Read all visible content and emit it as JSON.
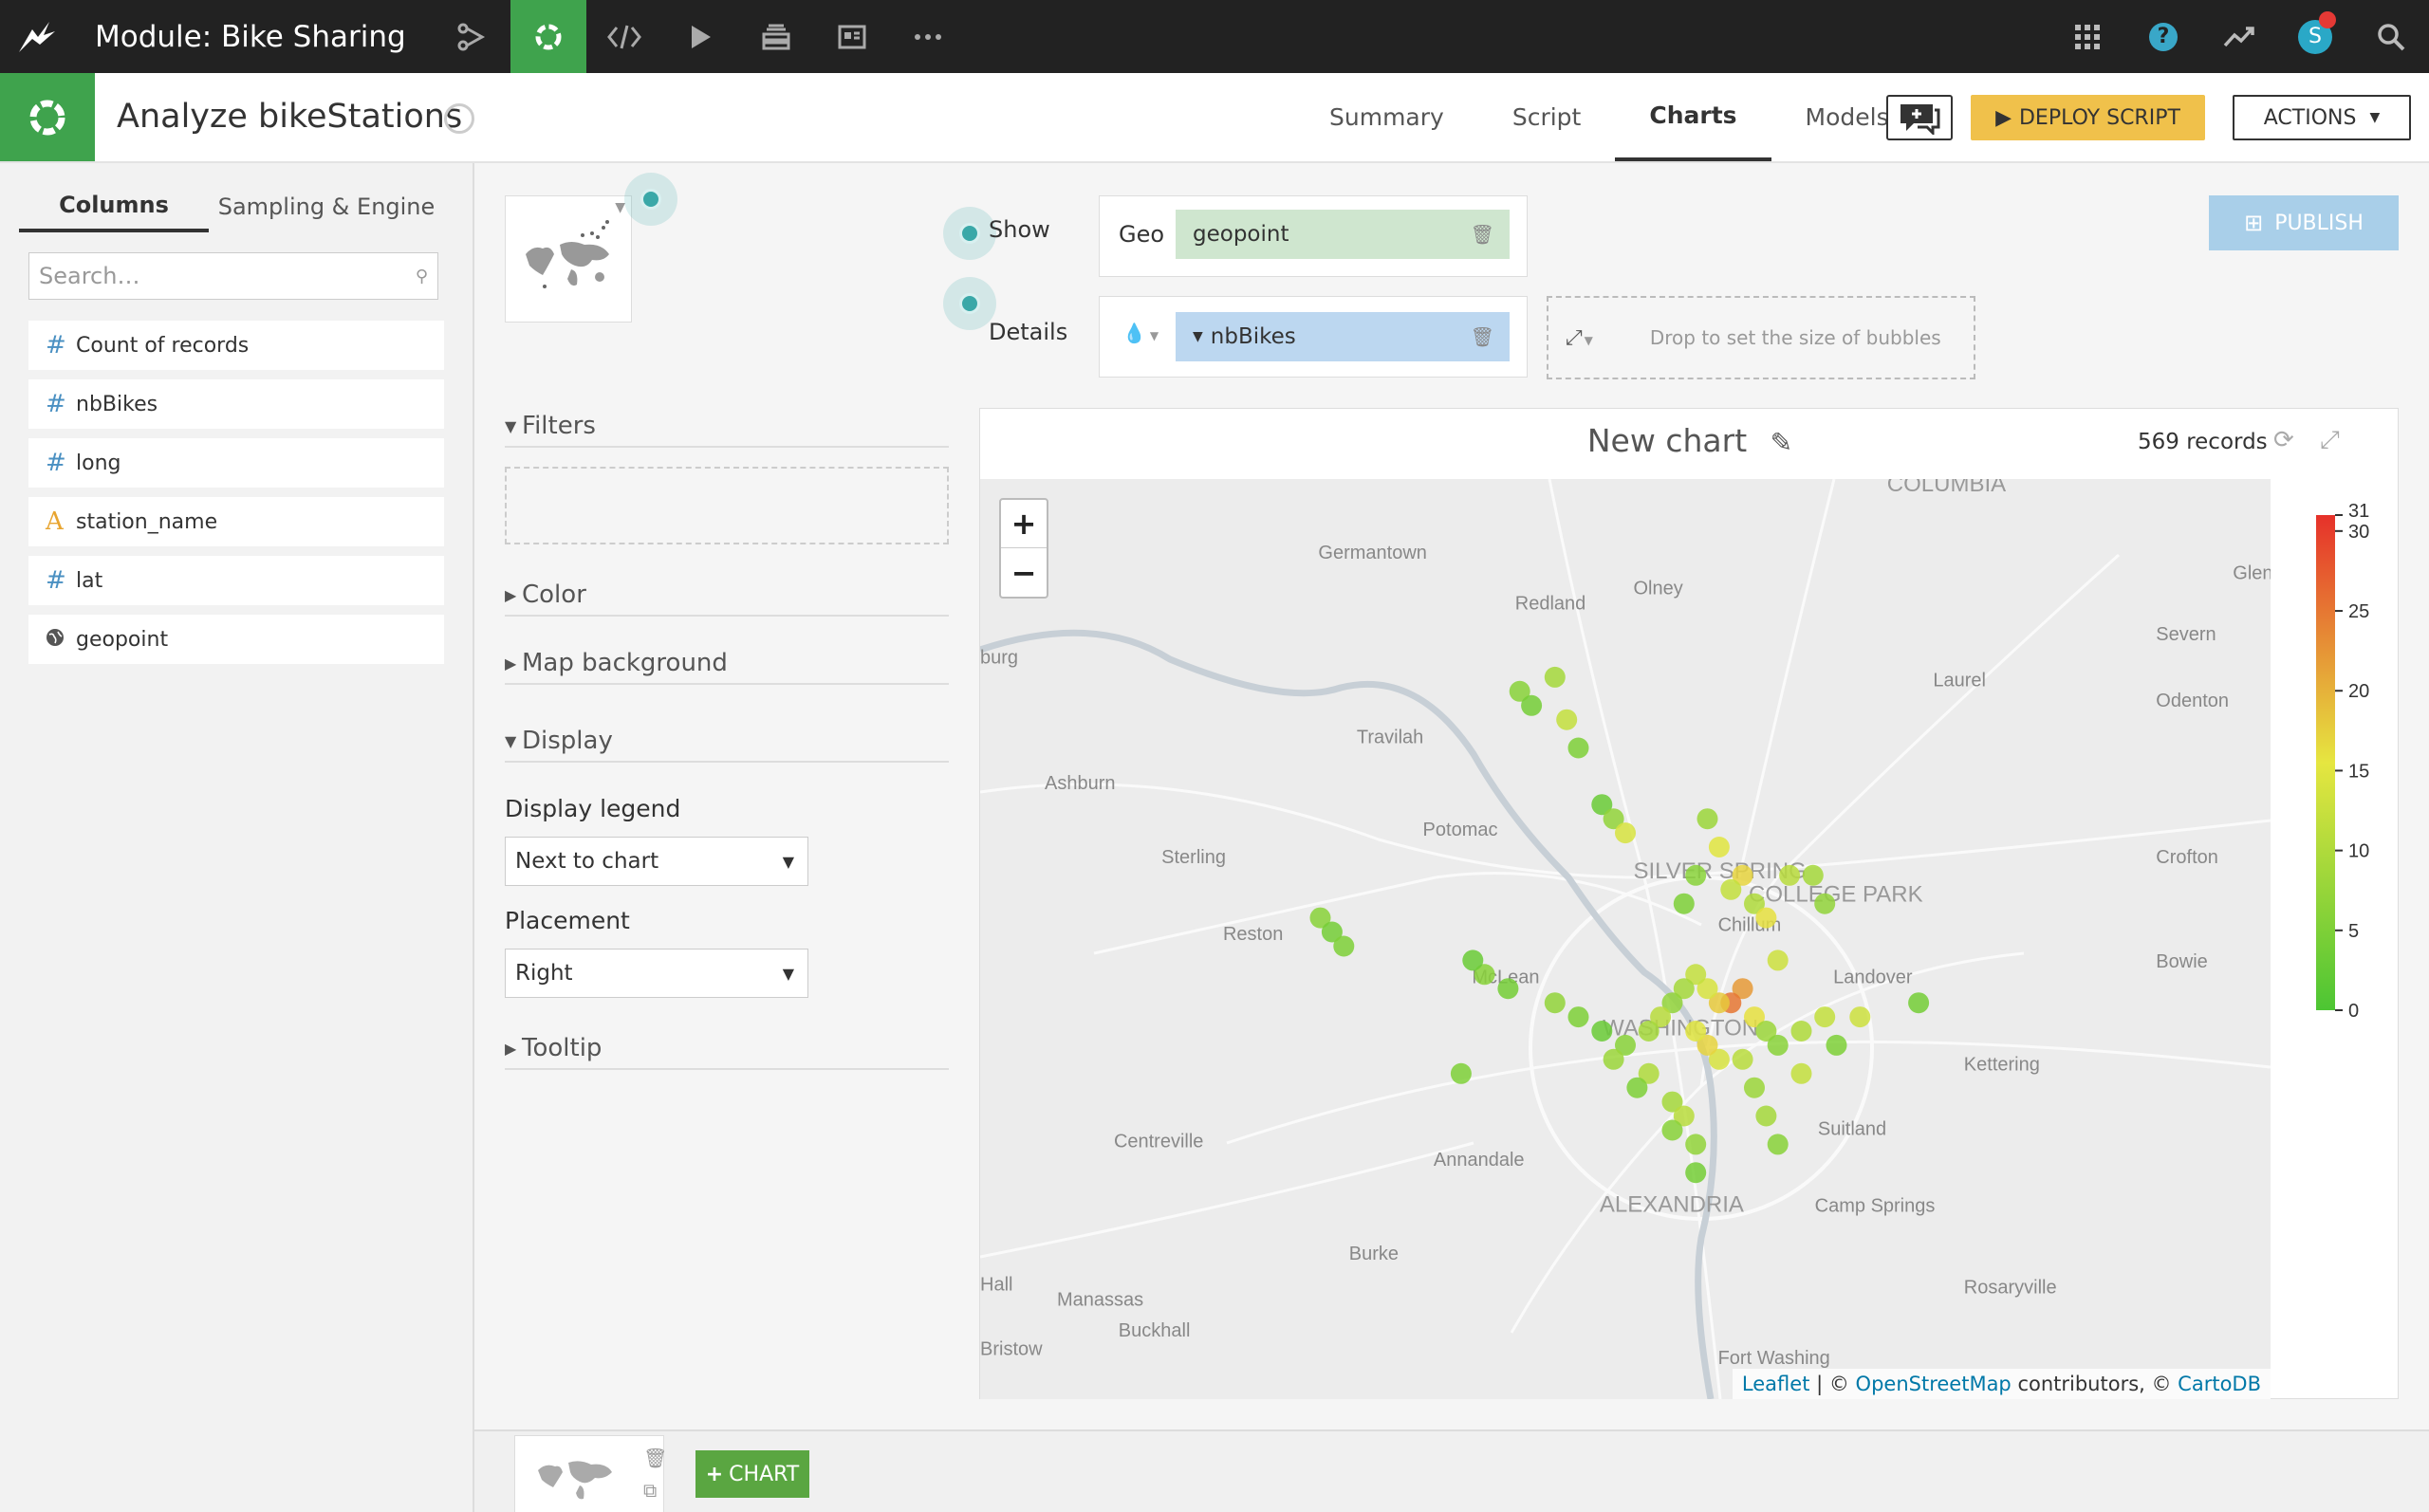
{
  "topbar": {
    "module_title": "Module: Bike Sharing",
    "nav_icons": [
      "flow-icon",
      "analysis-icon",
      "code-icon",
      "run-icon",
      "jobs-icon",
      "dashboard-icon",
      "more-icon"
    ],
    "user_initial": "S"
  },
  "subheader": {
    "title": "Analyze bikeStations",
    "tabs": [
      "Summary",
      "Script",
      "Charts",
      "Models"
    ],
    "active_tab": "Charts",
    "deploy_label": "DEPLOY SCRIPT",
    "actions_label": "ACTIONS"
  },
  "left_panel": {
    "tabs": [
      "Columns",
      "Sampling & Engine"
    ],
    "search_placeholder": "Search…",
    "columns": [
      {
        "type": "#",
        "name": "Count of records"
      },
      {
        "type": "#",
        "name": "nbBikes"
      },
      {
        "type": "#",
        "name": "long"
      },
      {
        "type": "A",
        "name": "station_name"
      },
      {
        "type": "#",
        "name": "lat"
      },
      {
        "type": "globe",
        "name": "geopoint"
      }
    ]
  },
  "config": {
    "show_label": "Show",
    "details_label": "Details",
    "geo_label": "Geo",
    "geo_value": "geopoint",
    "color_value": "nbBikes",
    "size_placeholder": "Drop to set the size of bubbles",
    "publish_label": "PUBLISH",
    "sections": {
      "filters": "Filters",
      "color": "Color",
      "map_background": "Map background",
      "display": "Display",
      "tooltip": "Tooltip"
    },
    "display_legend_label": "Display legend",
    "display_legend_value": "Next to chart",
    "placement_label": "Placement",
    "placement_value": "Right"
  },
  "chart": {
    "title": "New chart",
    "records": "569 records",
    "attribution": {
      "leaflet": "Leaflet",
      "sep1": " | © ",
      "osm": "OpenStreetMap",
      "mid": " contributors, © ",
      "carto": "CartoDB"
    },
    "legend": {
      "ticks": [
        0,
        5,
        10,
        15,
        20,
        25,
        30,
        31
      ],
      "min": 0,
      "max": 31,
      "colors": [
        "#4cc533",
        "#e6e640",
        "#e6312a"
      ]
    },
    "map_labels": [
      "Germantown",
      "Redland",
      "Olney",
      "Glen",
      "Severn",
      "Laurel",
      "Odenton",
      "burg",
      "Travilah",
      "Ashburn",
      "Potomac",
      "Sterling",
      "SILVER SPRING",
      "COLLEGE PARK",
      "Crofton",
      "Chillum",
      "Reston",
      "McLean",
      "Landover",
      "Bowie",
      "WASHINGTON",
      "Kettering",
      "Centreville",
      "Annandale",
      "Suitland",
      "ALEXANDRIA",
      "Camp Springs",
      "Burke",
      "Hall",
      "Manassas",
      "Buckhall",
      "Bristow",
      "Rosaryville",
      "Fort Washing",
      "COLUMBIA"
    ],
    "zoom_in": "+",
    "zoom_out": "−"
  },
  "bottom": {
    "add_chart_label": "CHART"
  },
  "chart_data": {
    "type": "scatter",
    "title": "New chart",
    "records": 569,
    "color_by": "nbBikes",
    "color_range": [
      0,
      31
    ],
    "points": [
      [
        -77.19,
        39.12,
        6
      ],
      [
        -77.18,
        39.11,
        4
      ],
      [
        -77.16,
        39.13,
        9
      ],
      [
        -77.15,
        39.1,
        12
      ],
      [
        -77.14,
        39.08,
        5
      ],
      [
        -77.12,
        39.04,
        3
      ],
      [
        -77.11,
        39.03,
        7
      ],
      [
        -77.1,
        39.02,
        14
      ],
      [
        -77.03,
        39.03,
        8
      ],
      [
        -77.02,
        39.01,
        15
      ],
      [
        -77.0,
        38.99,
        17
      ],
      [
        -77.01,
        38.98,
        12
      ],
      [
        -77.04,
        38.99,
        6
      ],
      [
        -77.05,
        38.97,
        5
      ],
      [
        -76.99,
        38.97,
        10
      ],
      [
        -76.98,
        38.96,
        16
      ],
      [
        -76.96,
        38.99,
        11
      ],
      [
        -76.94,
        38.99,
        9
      ],
      [
        -76.93,
        38.97,
        7
      ],
      [
        -76.97,
        38.93,
        13
      ],
      [
        -77.0,
        38.91,
        22
      ],
      [
        -77.01,
        38.9,
        25
      ],
      [
        -77.02,
        38.9,
        18
      ],
      [
        -77.03,
        38.91,
        14
      ],
      [
        -77.04,
        38.92,
        12
      ],
      [
        -77.05,
        38.91,
        9
      ],
      [
        -77.06,
        38.9,
        7
      ],
      [
        -77.07,
        38.89,
        11
      ],
      [
        -76.99,
        38.89,
        16
      ],
      [
        -76.98,
        38.88,
        8
      ],
      [
        -76.97,
        38.87,
        6
      ],
      [
        -76.95,
        38.88,
        10
      ],
      [
        -76.93,
        38.89,
        12
      ],
      [
        -76.92,
        38.87,
        5
      ],
      [
        -76.9,
        38.89,
        13
      ],
      [
        -76.85,
        38.9,
        4
      ],
      [
        -77.08,
        38.88,
        9
      ],
      [
        -77.1,
        38.87,
        6
      ],
      [
        -77.11,
        38.86,
        8
      ],
      [
        -77.12,
        38.88,
        3
      ],
      [
        -77.14,
        38.89,
        5
      ],
      [
        -77.16,
        38.9,
        7
      ],
      [
        -77.2,
        38.91,
        4
      ],
      [
        -77.22,
        38.92,
        6
      ],
      [
        -77.23,
        38.93,
        3
      ],
      [
        -77.24,
        38.85,
        5
      ],
      [
        -77.06,
        38.83,
        9
      ],
      [
        -77.05,
        38.82,
        11
      ],
      [
        -77.04,
        38.8,
        7
      ],
      [
        -77.06,
        38.81,
        6
      ],
      [
        -77.08,
        38.85,
        10
      ],
      [
        -77.09,
        38.84,
        5
      ],
      [
        -77.04,
        38.78,
        4
      ],
      [
        -76.99,
        38.84,
        8
      ],
      [
        -76.98,
        38.82,
        9
      ],
      [
        -76.97,
        38.8,
        6
      ],
      [
        -76.95,
        38.85,
        12
      ],
      [
        -77.36,
        38.96,
        6
      ],
      [
        -77.35,
        38.95,
        4
      ],
      [
        -77.34,
        38.94,
        5
      ],
      [
        -77.02,
        38.86,
        14
      ],
      [
        -77.03,
        38.87,
        17
      ],
      [
        -77.0,
        38.86,
        11
      ],
      [
        -77.04,
        38.88,
        15
      ]
    ]
  }
}
